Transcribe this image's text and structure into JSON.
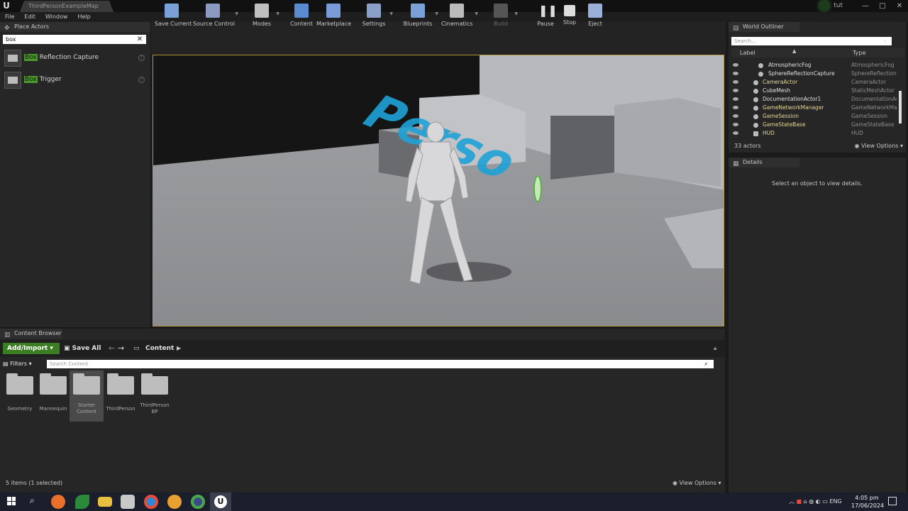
{
  "window": {
    "map_tab": "ThirdPersonExampleMap",
    "user": "tut"
  },
  "menu": [
    "File",
    "Edit",
    "Window",
    "Help"
  ],
  "place_actors": {
    "title": "Place Actors",
    "search_value": "box",
    "items": [
      {
        "highlight": "Box",
        "rest": " Reflection Capture"
      },
      {
        "highlight": "Box",
        "rest": " Trigger"
      }
    ]
  },
  "toolbar": [
    {
      "label": "Save Current",
      "color": "#7aa0d8"
    },
    {
      "label": "Source Control",
      "color": "#8a9ac0"
    },
    {
      "label": "Modes",
      "color": "#c0c0c0"
    },
    {
      "label": "Content",
      "color": "#5a8ad0"
    },
    {
      "label": "Marketplace",
      "color": "#7a9ad8"
    },
    {
      "label": "Settings",
      "color": "#8aa0c8"
    },
    {
      "label": "Blueprints",
      "color": "#7aa0d8"
    },
    {
      "label": "Cinematics",
      "color": "#bbbbbb"
    },
    {
      "label": "Build",
      "color": "#555555"
    },
    {
      "label": "Pause",
      "color": "#dddddd"
    },
    {
      "label": "Stop",
      "color": "#dddddd"
    },
    {
      "label": "Eject",
      "color": "#9ab0d8"
    }
  ],
  "outliner": {
    "title": "World Outliner",
    "search_placeholder": "Search...",
    "col_label": "Label",
    "col_type": "Type",
    "rows": [
      {
        "label": "AtmosphericFog",
        "type": "AtmosphericFog"
      },
      {
        "label": "SphereReflectionCapture",
        "type": "SphereReflectionC"
      },
      {
        "label": "CameraActor",
        "type": "CameraActor"
      },
      {
        "label": "CubeMesh",
        "type": "StaticMeshActor"
      },
      {
        "label": "DocumentationActor1",
        "type": "DocumentationAc"
      },
      {
        "label": "GameNetworkManager",
        "type": "GameNetworkMar"
      },
      {
        "label": "GameSession",
        "type": "GameSession"
      },
      {
        "label": "GameStateBase",
        "type": "GameStateBase"
      },
      {
        "label": "HUD",
        "type": "HUD"
      }
    ],
    "count": "33 actors",
    "view_options": "View Options"
  },
  "details": {
    "title": "Details",
    "message": "Select an object to view details."
  },
  "content_browser": {
    "title": "Content Browser",
    "add_import": "Add/Import",
    "save_all": "Save All",
    "path": "Content",
    "filters": "Filters",
    "search_placeholder": "Search Content",
    "folders": [
      "Geometry",
      "Mannequin",
      "Starter Content",
      "ThirdPerson",
      "ThirdPerson BP"
    ],
    "status": "5 items (1 selected)",
    "view_options": "View Options"
  },
  "viewport": {
    "floor_text": "Perso"
  },
  "taskbar": {
    "lang": "ENG",
    "time": "4:05 pm",
    "date": "17/06/2024"
  }
}
